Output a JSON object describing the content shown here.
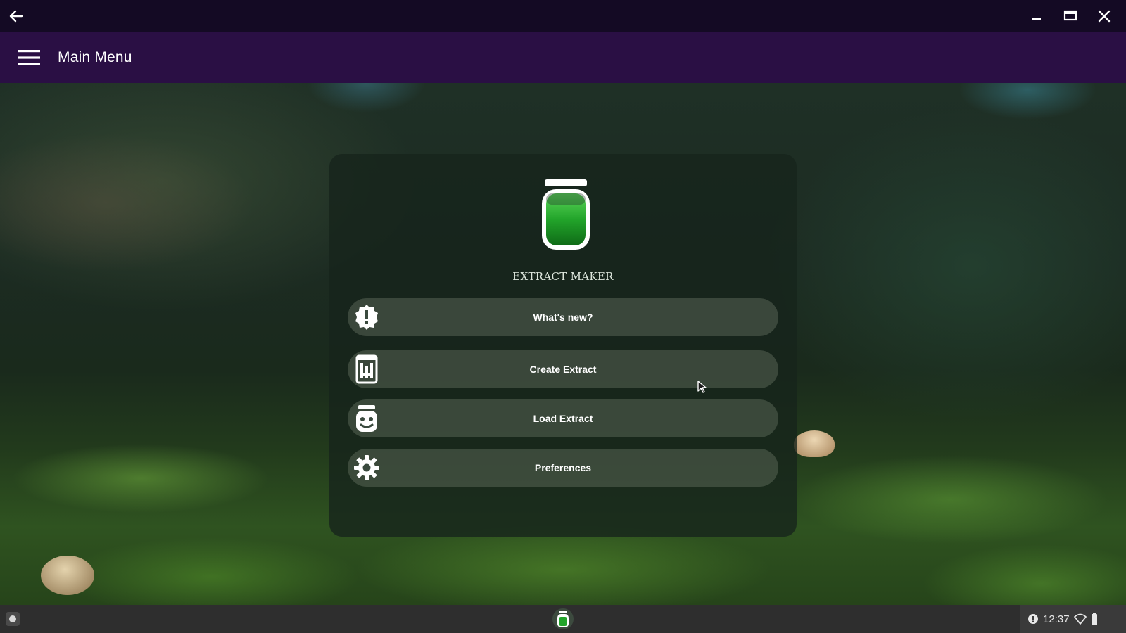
{
  "window": {
    "back_icon": "arrow-left-icon",
    "controls": [
      "minimize-icon",
      "restore-icon",
      "close-icon"
    ]
  },
  "appbar": {
    "menu_icon": "hamburger-menu-icon",
    "title": "Main Menu"
  },
  "panel": {
    "app_name": "EXTRACT MAKER",
    "logo_icon": "jar-icon",
    "buttons": [
      {
        "label": "What's new?",
        "icon": "info-badge-icon"
      },
      {
        "label": "Create Extract",
        "icon": "beaker-icon"
      },
      {
        "label": "Load Extract",
        "icon": "jar-face-icon"
      },
      {
        "label": "Preferences",
        "icon": "gear-icon"
      }
    ]
  },
  "shelf": {
    "launcher_icon": "launcher-icon",
    "pinned_app_icon": "extract-maker-jar-icon",
    "status": {
      "notification_icon": "notification-icon",
      "time": "12:37",
      "wifi_icon": "wifi-icon",
      "battery_icon": "battery-icon"
    }
  },
  "colors": {
    "titlebar": "#140a24",
    "appbar": "#2a0f44",
    "jar_liquid": "#1f9a2a",
    "button_bg": "#6c7666",
    "shelf": "#2e2e2e"
  }
}
